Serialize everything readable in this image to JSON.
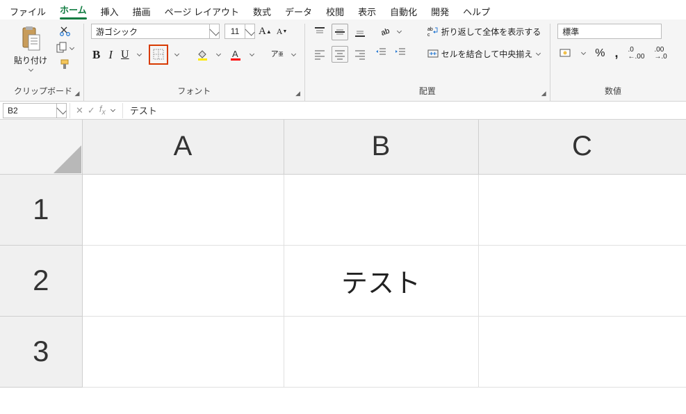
{
  "menu": {
    "file": "ファイル",
    "home": "ホーム",
    "insert": "挿入",
    "draw": "描画",
    "layout": "ページ レイアウト",
    "formulas": "数式",
    "data": "データ",
    "review": "校閲",
    "view": "表示",
    "automate": "自動化",
    "developer": "開発",
    "help": "ヘルプ"
  },
  "clipboard": {
    "paste": "貼り付け",
    "label": "クリップボード"
  },
  "font": {
    "name": "游ゴシック",
    "size": "11",
    "label": "フォント"
  },
  "alignment": {
    "label": "配置",
    "wrap": "折り返して全体を表示する",
    "merge": "セルを結合して中央揃え"
  },
  "number": {
    "format": "標準",
    "label": "数値"
  },
  "namebox": "B2",
  "formula": "テスト",
  "cols": [
    "A",
    "B",
    "C"
  ],
  "rows": [
    "1",
    "2",
    "3"
  ],
  "cells": {
    "B2": "テスト"
  }
}
